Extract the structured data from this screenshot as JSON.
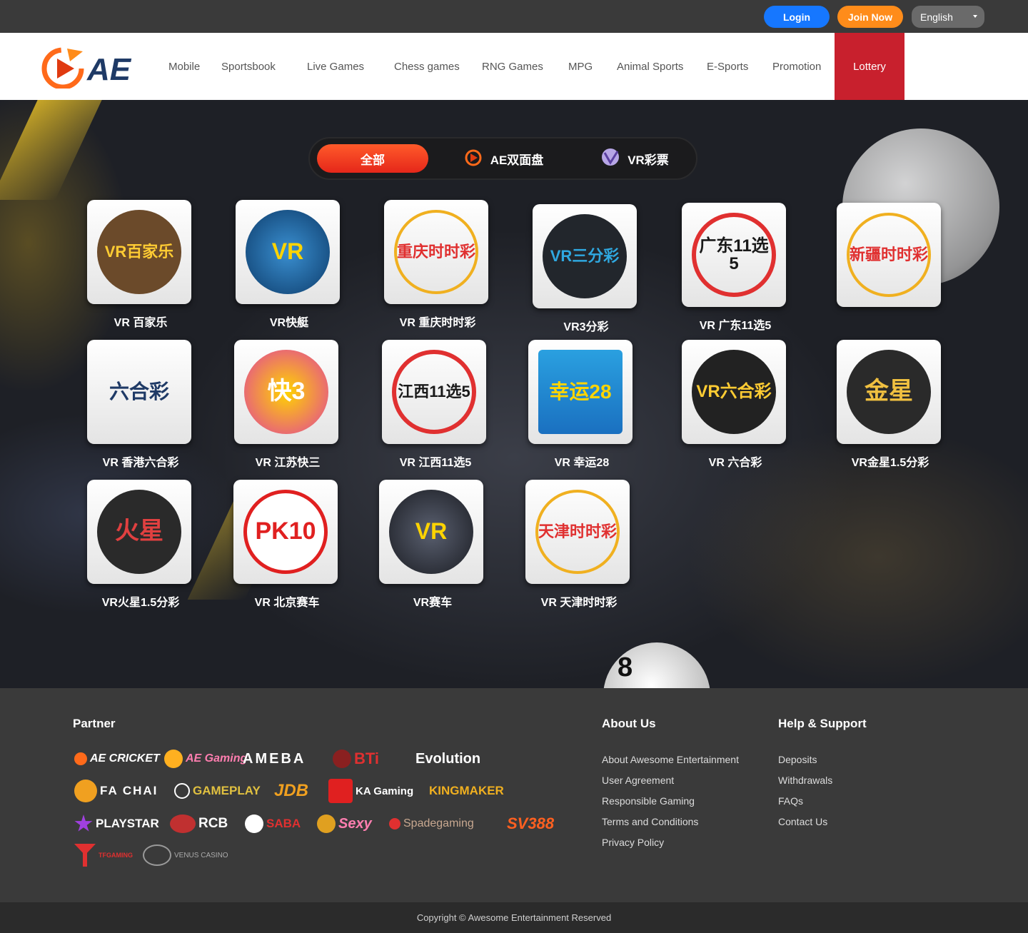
{
  "header": {
    "login_label": "Login",
    "join_label": "Join Now",
    "language": "English"
  },
  "brand": {
    "logo_text": "AE",
    "accent": "#ff6a1a",
    "active_nav_color": "#c8202d"
  },
  "nav": {
    "items": [
      "Mobile",
      "Sportsbook",
      "Live Games",
      "Chess games",
      "RNG Games",
      "MPG",
      "Animal Sports",
      "E-Sports",
      "Promotion",
      "Lottery"
    ],
    "active": "Lottery"
  },
  "tabs": [
    {
      "label": "全部",
      "icon": "none",
      "active": true
    },
    {
      "label": "AE双面盘",
      "icon": "ae-logo-icon",
      "active": false
    },
    {
      "label": "VR彩票",
      "icon": "vr-logo-icon",
      "active": false
    }
  ],
  "games": [
    {
      "label": "VR 百家乐",
      "art": "VR百家乐"
    },
    {
      "label": "VR快艇",
      "art": "VR"
    },
    {
      "label": "VR 重庆时时彩",
      "art": "重庆时时彩"
    },
    {
      "label": "VR3分彩",
      "art": "VR三分彩"
    },
    {
      "label": "VR 广东11选5",
      "art": "广东11选5"
    },
    {
      "label": "",
      "art": "新疆时时彩"
    },
    {
      "label": "VR 香港六合彩",
      "art": "六合彩"
    },
    {
      "label": "VR 江苏快三",
      "art": "快3"
    },
    {
      "label": "VR 江西11选5",
      "art": "江西11选5"
    },
    {
      "label": "VR 幸运28",
      "art": "幸运28"
    },
    {
      "label": "VR 六合彩",
      "art": "VR六合彩"
    },
    {
      "label": "VR金星1.5分彩",
      "art": "金星"
    },
    {
      "label": "VR火星1.5分彩",
      "art": "火星"
    },
    {
      "label": "VR 北京赛车",
      "art": "PK10"
    },
    {
      "label": "VR赛车",
      "art": "VR"
    },
    {
      "label": "VR 天津时时彩",
      "art": "天津时时彩"
    }
  ],
  "footer": {
    "partner_heading": "Partner",
    "about_heading": "About Us",
    "help_heading": "Help & Support",
    "partners": [
      "AE CRICKET",
      "AE Gaming",
      "AMEBA",
      "BTi",
      "Evolution",
      "FA CHAI",
      "GAMEPLAY",
      "JDB",
      "KA Gaming",
      "KINGMAKER",
      "PLAYSTAR",
      "RCB",
      "SABA",
      "Sexy",
      "Spadegaming",
      "SV388",
      "TFGAMING",
      "VENUS CASINO"
    ],
    "about_links": [
      "About Awesome Entertainment",
      "User Agreement",
      "Responsible Gaming",
      "Terms and Conditions",
      "Privacy Policy"
    ],
    "help_links": [
      "Deposits",
      "Withdrawals",
      "FAQs",
      "Contact Us"
    ],
    "copyright": "Copyright © Awesome Entertainment Reserved"
  }
}
